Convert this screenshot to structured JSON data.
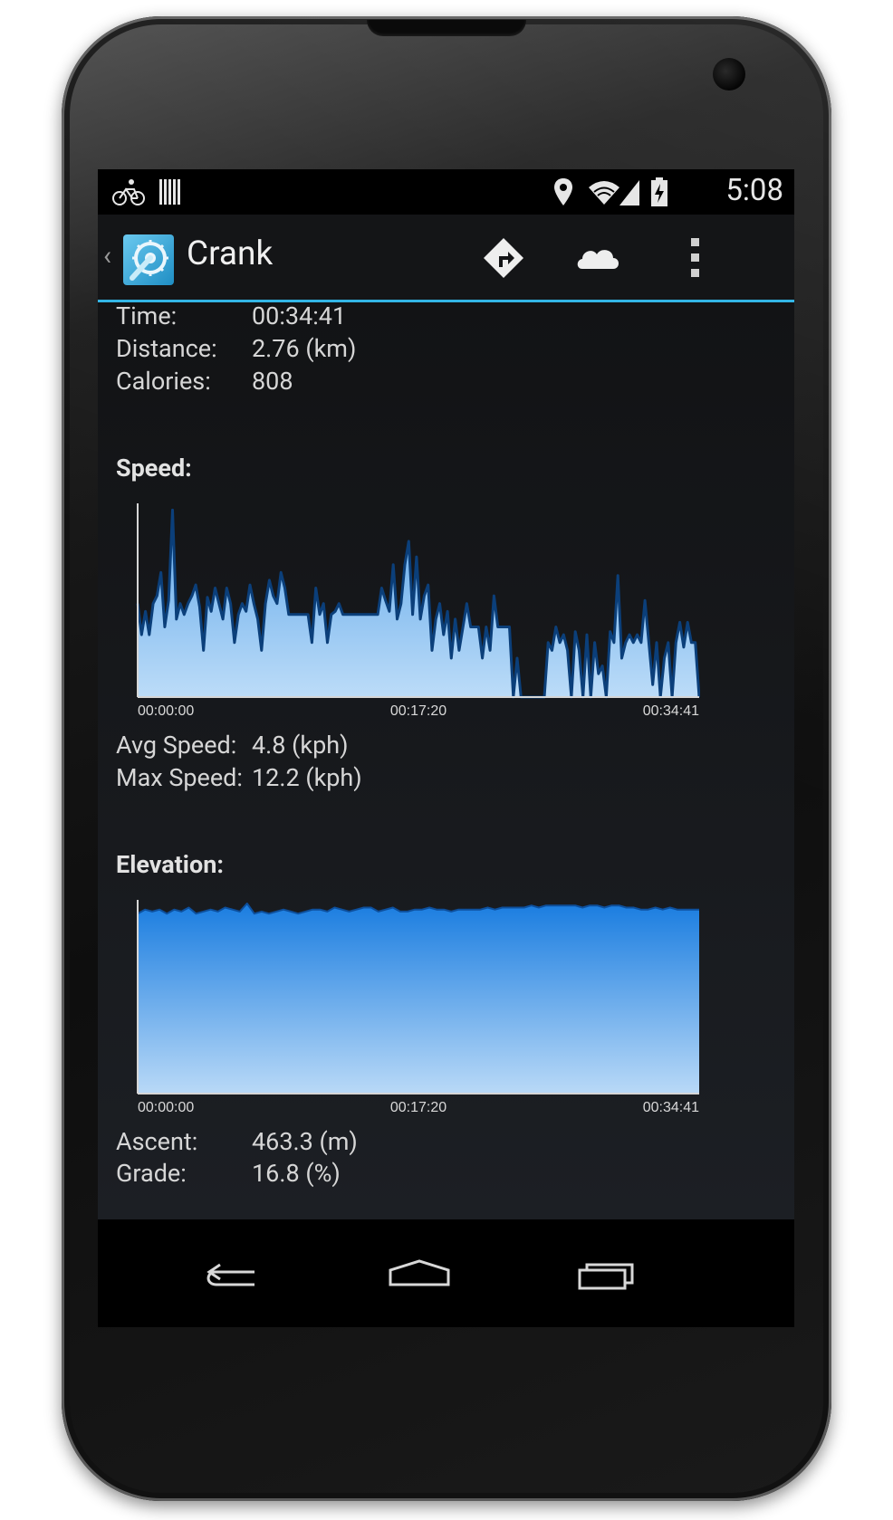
{
  "status_bar": {
    "time": "5:08",
    "left_icons": [
      "bicycle-icon",
      "barcode-icon"
    ],
    "right_icons": [
      "location-pin-icon",
      "wifi-icon",
      "signal-icon",
      "battery-charging-icon"
    ]
  },
  "action_bar": {
    "title": "Crank",
    "actions": [
      "directions-icon",
      "cloud-icon",
      "overflow-menu-icon"
    ]
  },
  "summary": {
    "time_label": "Time:",
    "time_value": "00:34:41",
    "distance_label": "Distance:",
    "distance_value": "2.76  (km)",
    "calories_label": "Calories:",
    "calories_value": "808"
  },
  "speed_section": {
    "title": "Speed:",
    "avg_label": "Avg Speed:",
    "avg_value": "4.8  (kph)",
    "max_label": "Max Speed:",
    "max_value": "12.2  (kph)"
  },
  "elevation_section": {
    "title": "Elevation:",
    "ascent_label": "Ascent:",
    "ascent_value": "463.3  (m)",
    "grade_label": "Grade:",
    "grade_value": "16.8  (%)"
  },
  "chart_data": [
    {
      "type": "area",
      "title": "Speed:",
      "x_tick_labels": [
        "00:00:00",
        "00:17:20",
        "00:34:41"
      ],
      "xlim": [
        0,
        2081
      ],
      "ylim": [
        0,
        12.2
      ],
      "grid": false,
      "y_axis_labels_shown": false,
      "values": [
        6,
        4,
        5.5,
        4,
        6,
        6.5,
        8,
        4.5,
        6.2,
        12,
        5,
        6,
        5.3,
        6,
        6.5,
        7.2,
        5.8,
        3,
        6.4,
        5.5,
        7,
        6,
        5,
        7,
        6,
        3.5,
        5.3,
        6,
        5.5,
        7.2,
        6,
        5,
        3,
        6,
        7.5,
        6.5,
        6,
        8,
        7,
        5.3,
        5.3,
        5.3,
        5.3,
        5.3,
        5.3,
        3.5,
        7,
        5.3,
        6,
        3.5,
        5.3,
        5.5,
        6,
        5.3,
        5.3,
        5.3,
        5.3,
        5.3,
        5.3,
        5.3,
        5.3,
        5.3,
        5.3,
        7,
        6.2,
        5.5,
        8.5,
        5,
        6,
        8.5,
        10,
        5.3,
        9,
        5,
        6.5,
        7.2,
        3,
        5,
        6,
        4,
        5.5,
        2.5,
        5,
        3,
        4.5,
        6,
        4.5,
        4.5,
        4.5,
        2.5,
        4.5,
        3,
        6.5,
        4.5,
        4.5,
        4.5,
        4.5,
        0,
        2.5,
        0,
        0,
        0,
        0,
        0,
        0,
        0,
        3.5,
        3,
        4.5,
        3.5,
        4,
        3,
        0,
        4.2,
        3,
        0,
        4,
        0,
        3.5,
        1.5,
        2,
        0,
        4.2,
        3.5,
        7.8,
        2.5,
        3.5,
        4,
        3.5,
        4,
        3.5,
        6.2,
        3.5,
        0.8,
        3.5,
        0,
        2.5,
        3.5,
        0,
        3.5,
        4.8,
        3.2,
        4.8,
        3.5,
        3.5,
        0
      ]
    },
    {
      "type": "area",
      "title": "Elevation:",
      "x_tick_labels": [
        "00:00:00",
        "00:17:20",
        "00:34:41"
      ],
      "xlim": [
        0,
        2081
      ],
      "grid": false,
      "y_axis_labels_shown": false,
      "values": [
        89,
        91,
        90,
        91,
        89,
        91,
        90,
        92,
        89,
        90,
        91,
        90,
        92,
        91,
        90,
        94,
        89,
        90,
        89,
        90,
        91,
        90,
        89,
        90,
        91,
        91,
        90,
        92,
        91,
        90,
        91,
        92,
        92,
        90,
        91,
        92,
        90,
        90,
        91,
        91,
        92,
        91,
        91,
        90,
        91,
        91,
        91,
        91,
        92,
        91,
        92,
        92,
        92,
        92,
        93,
        92,
        93,
        93,
        93,
        93,
        93,
        92,
        93,
        93,
        92,
        93,
        93,
        92,
        92,
        91,
        91,
        92,
        91,
        92,
        91,
        91,
        91,
        91
      ]
    }
  ],
  "nav_bar": {
    "buttons": [
      "back-icon",
      "home-icon",
      "recent-apps-icon"
    ]
  }
}
